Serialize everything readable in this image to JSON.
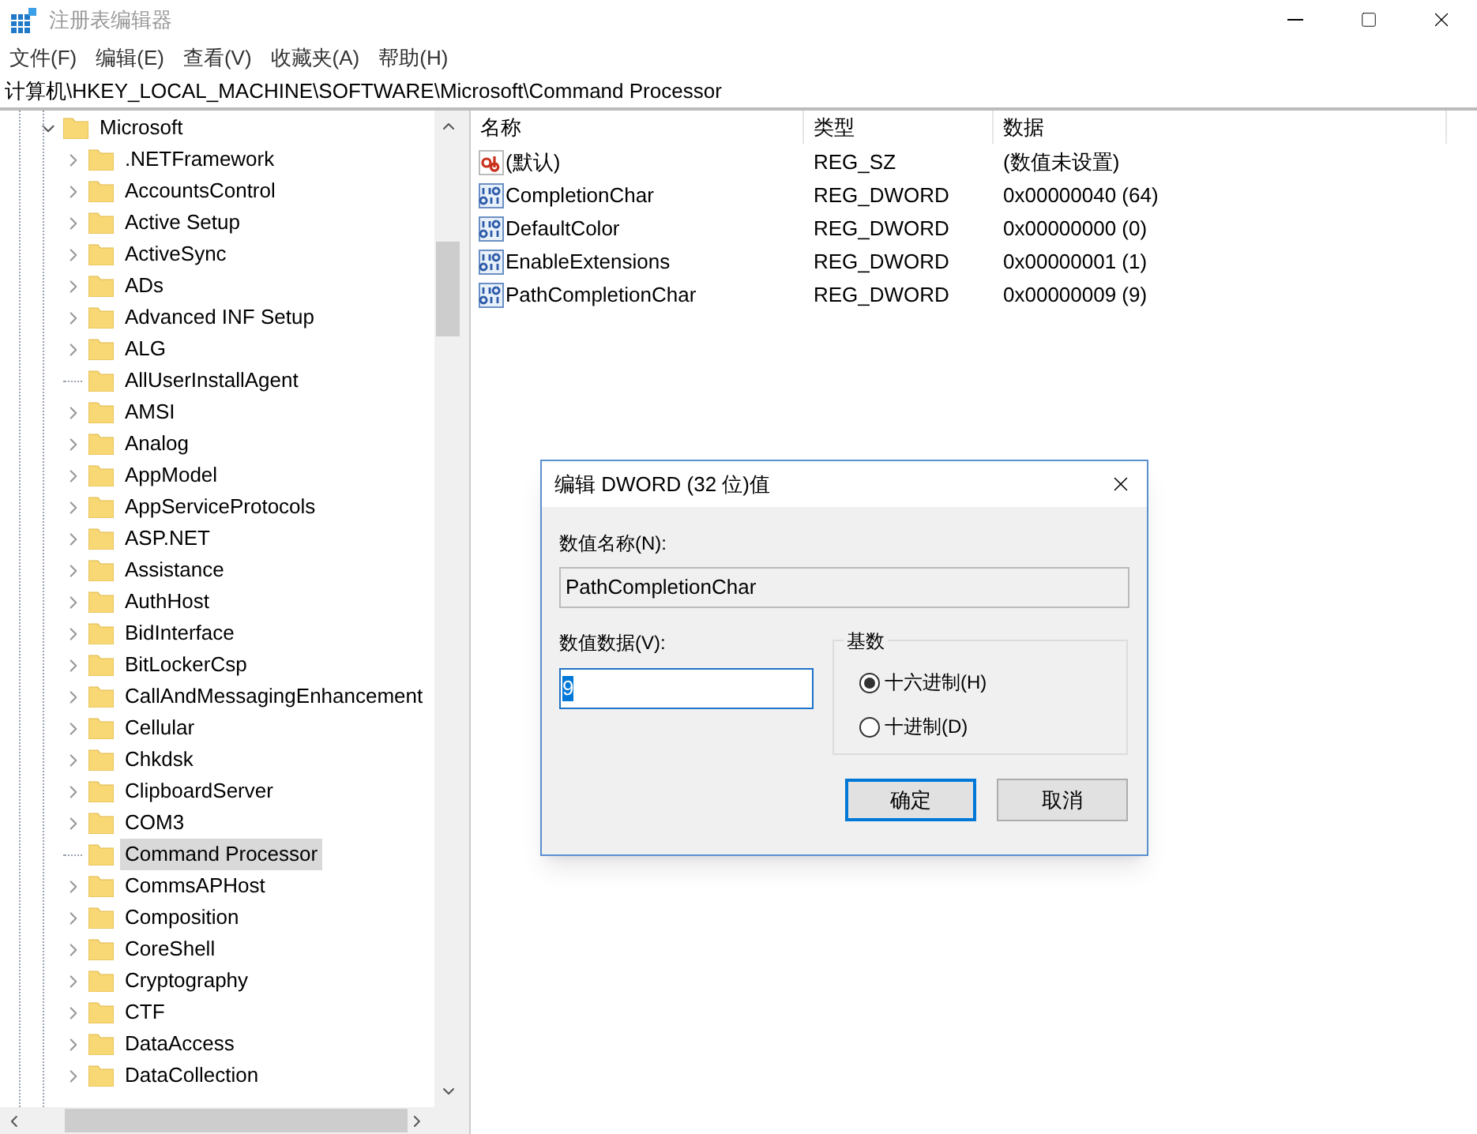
{
  "window": {
    "title": "注册表编辑器"
  },
  "menu": [
    "文件(F)",
    "编辑(E)",
    "查看(V)",
    "收藏夹(A)",
    "帮助(H)"
  ],
  "address": "计算机\\HKEY_LOCAL_MACHINE\\SOFTWARE\\Microsoft\\Command Processor",
  "tree": {
    "label": "Microsoft",
    "expanded": true,
    "selected": false,
    "children": [
      {
        "kind": "folder",
        "label": ".NETFramework",
        "selected": false
      },
      {
        "kind": "folder",
        "label": "AccountsControl",
        "selected": false
      },
      {
        "kind": "folder",
        "label": "Active Setup",
        "selected": false
      },
      {
        "kind": "folder",
        "label": "ActiveSync",
        "selected": false
      },
      {
        "kind": "folder",
        "label": "ADs",
        "selected": false
      },
      {
        "kind": "folder",
        "label": "Advanced INF Setup",
        "selected": false
      },
      {
        "kind": "folder",
        "label": "ALG",
        "selected": false
      },
      {
        "kind": "leaf",
        "label": "AllUserInstallAgent",
        "selected": false
      },
      {
        "kind": "folder",
        "label": "AMSI",
        "selected": false
      },
      {
        "kind": "folder",
        "label": "Analog",
        "selected": false
      },
      {
        "kind": "folder",
        "label": "AppModel",
        "selected": false
      },
      {
        "kind": "folder",
        "label": "AppServiceProtocols",
        "selected": false
      },
      {
        "kind": "folder",
        "label": "ASP.NET",
        "selected": false
      },
      {
        "kind": "folder",
        "label": "Assistance",
        "selected": false
      },
      {
        "kind": "folder",
        "label": "AuthHost",
        "selected": false
      },
      {
        "kind": "folder",
        "label": "BidInterface",
        "selected": false
      },
      {
        "kind": "folder",
        "label": "BitLockerCsp",
        "selected": false
      },
      {
        "kind": "folder",
        "label": "CallAndMessagingEnhancement",
        "selected": false
      },
      {
        "kind": "folder",
        "label": "Cellular",
        "selected": false
      },
      {
        "kind": "folder",
        "label": "Chkdsk",
        "selected": false
      },
      {
        "kind": "folder",
        "label": "ClipboardServer",
        "selected": false
      },
      {
        "kind": "folder",
        "label": "COM3",
        "selected": false
      },
      {
        "kind": "leaf",
        "label": "Command Processor",
        "selected": true
      },
      {
        "kind": "folder",
        "label": "CommsAPHost",
        "selected": false
      },
      {
        "kind": "folder",
        "label": "Composition",
        "selected": false
      },
      {
        "kind": "folder",
        "label": "CoreShell",
        "selected": false
      },
      {
        "kind": "folder",
        "label": "Cryptography",
        "selected": false
      },
      {
        "kind": "folder",
        "label": "CTF",
        "selected": false
      },
      {
        "kind": "folder",
        "label": "DataAccess",
        "selected": false
      },
      {
        "kind": "folder",
        "label": "DataCollection",
        "selected": false
      }
    ]
  },
  "table": {
    "columns": [
      "名称",
      "类型",
      "数据"
    ],
    "rows": [
      {
        "kind": "sz",
        "name": "(默认)",
        "type": "REG_SZ",
        "data": "(数值未设置)"
      },
      {
        "kind": "dword",
        "name": "CompletionChar",
        "type": "REG_DWORD",
        "data": "0x00000040 (64)"
      },
      {
        "kind": "dword",
        "name": "DefaultColor",
        "type": "REG_DWORD",
        "data": "0x00000000 (0)"
      },
      {
        "kind": "dword",
        "name": "EnableExtensions",
        "type": "REG_DWORD",
        "data": "0x00000001 (1)"
      },
      {
        "kind": "dword",
        "name": "PathCompletionChar",
        "type": "REG_DWORD",
        "data": "0x00000009 (9)"
      }
    ]
  },
  "dialog": {
    "title": "编辑 DWORD (32 位)值",
    "name_label": "数值名称(N):",
    "name_value": "PathCompletionChar",
    "data_label": "数值数据(V):",
    "data_value": "9",
    "base_label": "基数",
    "bases": [
      {
        "label": "十六进制(H)",
        "selected": true
      },
      {
        "label": "十进制(D)",
        "selected": false
      }
    ],
    "buttons": [
      {
        "label": "确定",
        "default": true
      },
      {
        "label": "取消",
        "default": false
      }
    ]
  }
}
